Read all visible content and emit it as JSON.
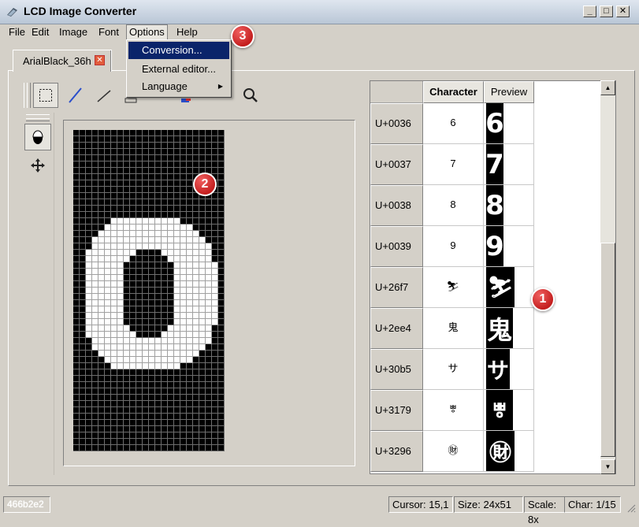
{
  "window": {
    "title": "LCD Image Converter",
    "controls": {
      "minimize": "_",
      "maximize": "□",
      "close": "✕"
    }
  },
  "menubar": {
    "items": [
      "File",
      "Edit",
      "Image",
      "Font",
      "Options",
      "Help"
    ],
    "open_menu": "Options"
  },
  "options_menu": {
    "items": [
      {
        "label": "Conversion...",
        "highlighted": true
      },
      {
        "label": "External editor..."
      },
      {
        "label": "Language",
        "submenu": true
      }
    ]
  },
  "tab": {
    "label": "ArialBlack_36h",
    "close": "✕"
  },
  "toolbar": {
    "tools": [
      "select-rect",
      "line-blue",
      "line",
      "rect",
      "color-picker",
      "color-swap",
      "zoom"
    ]
  },
  "editor": {
    "glyph": "0",
    "width": 24,
    "height": 51,
    "pixel_rows": [
      "........................",
      "........................",
      "........................",
      "........................",
      "........................",
      "........................",
      "........................",
      "........................",
      "........................",
      "........................",
      "........................",
      "........................",
      "........................",
      "........................",
      "......XXXXXXXXXXX.......",
      ".....XXXXXXXXXXXXXX.....",
      "....XXXXXXXXXXXXXXXX....",
      "...XXXXXXXXXXXXXXXXXX...",
      "...XXXXXXXXXXXXXXXXXXX..",
      "..XXXXXXXX....XXXXXXXX..",
      "..XXXXXXX......XXXXXXX..",
      "..XXXXXX........XXXXXXX.",
      "..XXXXXX........XXXXXXX.",
      "..XXXXXX........XXXXXXX.",
      "..XXXXXX........XXXXXXX.",
      "..XXXXXX........XXXXXXX.",
      "..XXXXXX........XXXXXXX.",
      "..XXXXXX........XXXXXXX.",
      "..XXXXXX........XXXXXXX.",
      "..XXXXXX........XXXXXXX.",
      "..XXXXXX........XXXXXXX.",
      "..XXXXXXX......XXXXXXX..",
      "..XXXXXXXX....XXXXXXXX..",
      "...XXXXXXXXXXXXXXXXXXX..",
      "...XXXXXXXXXXXXXXXXXX...",
      "....XXXXXXXXXXXXXXXX....",
      ".....XXXXXXXXXXXXXX.....",
      "......XXXXXXXXXXX.......",
      "........................",
      "........................",
      "........................",
      "........................",
      "........................",
      "........................",
      "........................",
      "........................",
      "........................",
      "........................",
      "........................",
      "........................",
      "........................"
    ]
  },
  "table": {
    "headers": {
      "character": "Character",
      "preview": "Preview"
    },
    "rows": [
      {
        "code": "U+0036",
        "char": "6",
        "preview": "6"
      },
      {
        "code": "U+0037",
        "char": "7",
        "preview": "7"
      },
      {
        "code": "U+0038",
        "char": "8",
        "preview": "8"
      },
      {
        "code": "U+0039",
        "char": "9",
        "preview": "9"
      },
      {
        "code": "U+26f7",
        "char": "⛷",
        "preview": "⛷"
      },
      {
        "code": "U+2ee4",
        "char": "⻤",
        "preview": "⻤"
      },
      {
        "code": "U+30b5",
        "char": "サ",
        "preview": "サ"
      },
      {
        "code": "U+3179",
        "char": "ㅹ",
        "preview": "ㅹ"
      },
      {
        "code": "U+3296",
        "char": "㊖",
        "preview": "㊖"
      }
    ]
  },
  "callouts": [
    "1",
    "2",
    "3"
  ],
  "statusbar": {
    "color": "466b2e2",
    "cursor": "Cursor: 15,1",
    "size": "Size: 24x51",
    "scale": "Scale: 8x",
    "char": "Char: 1/15"
  }
}
